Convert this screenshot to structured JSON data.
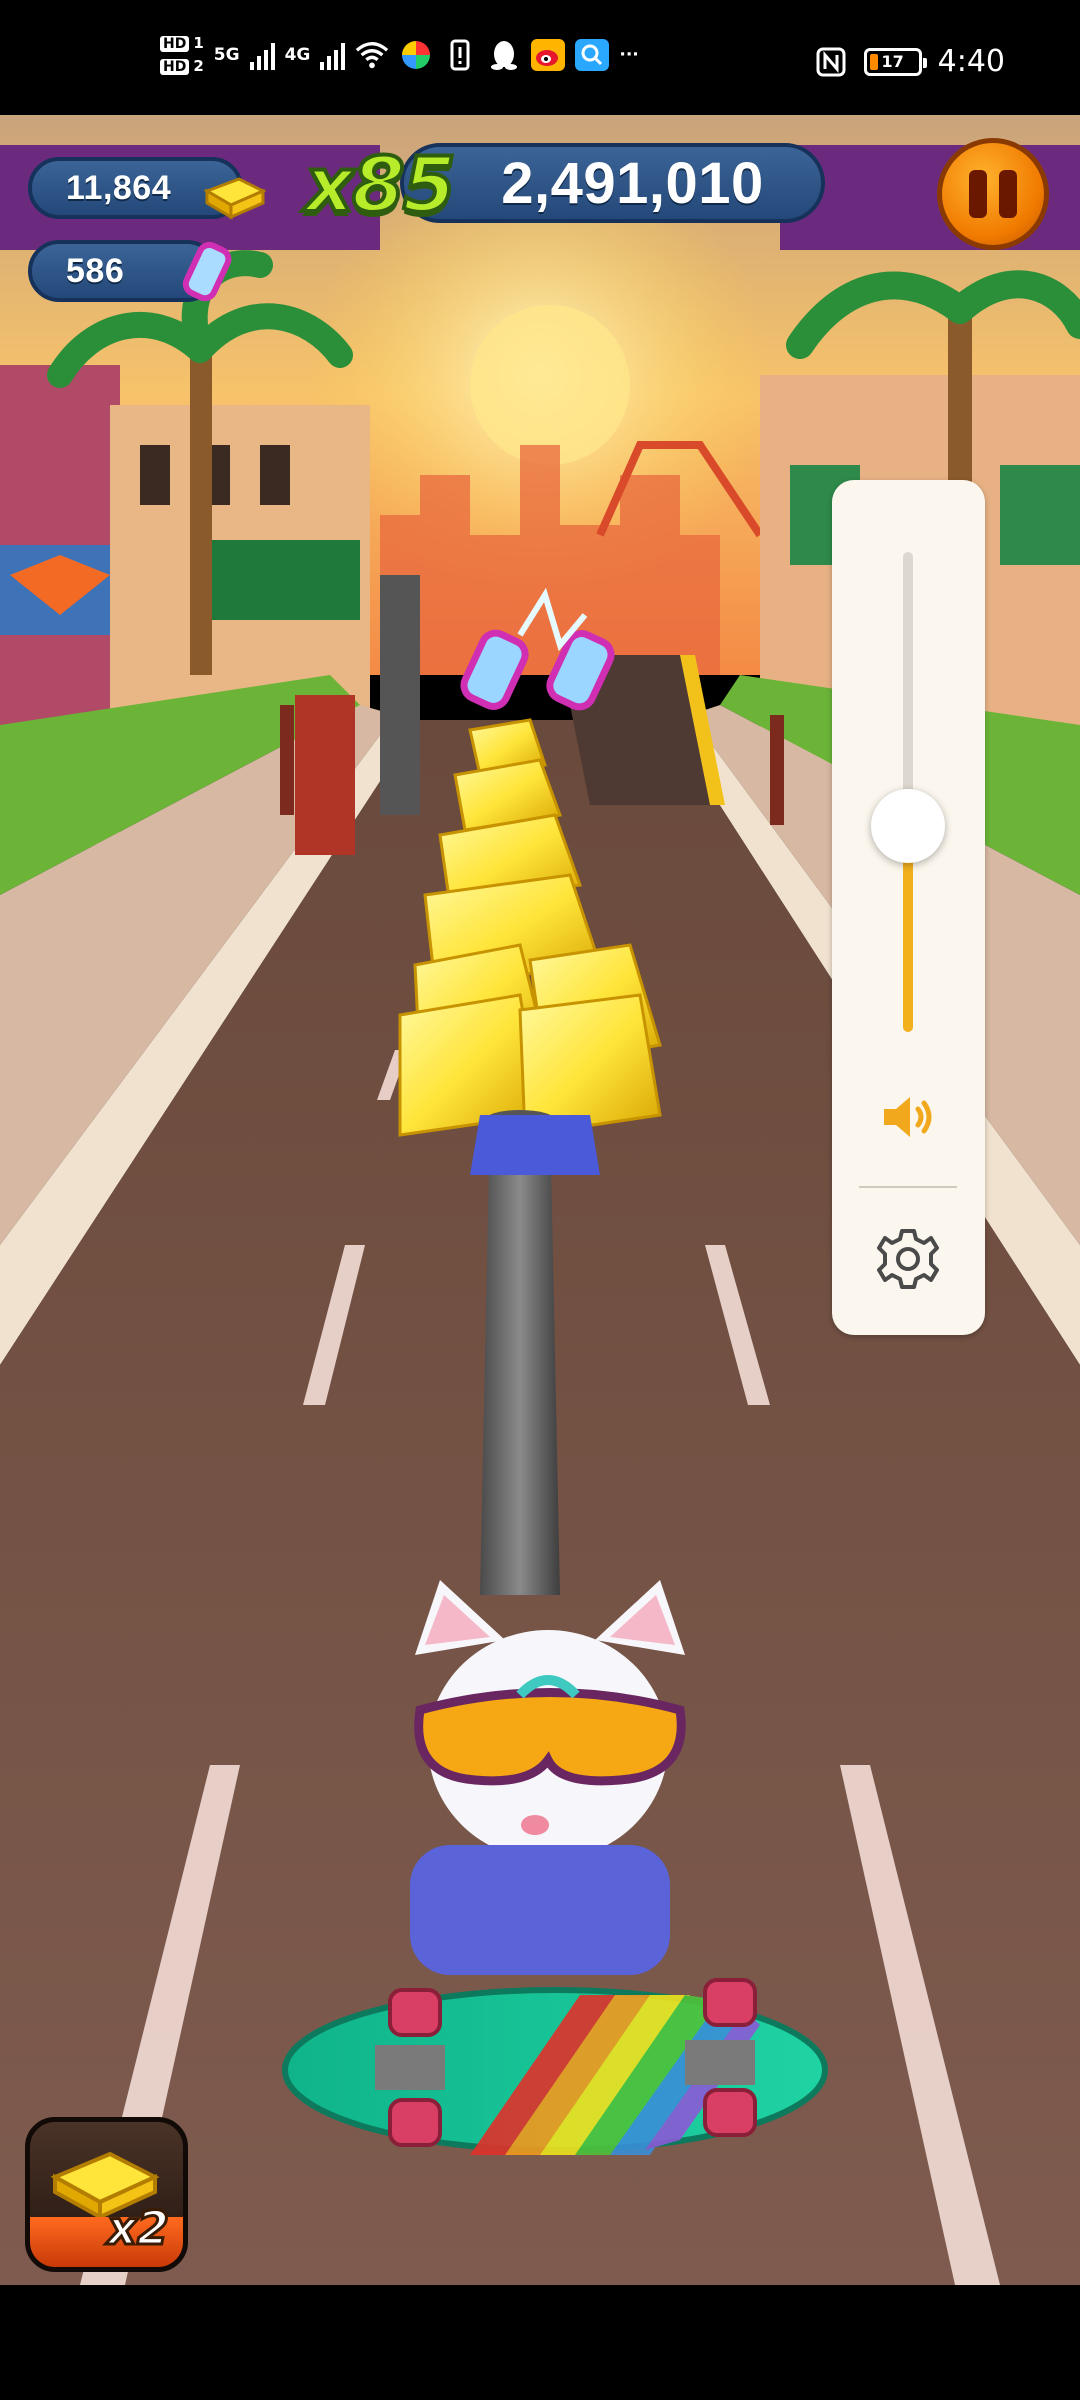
{
  "status_bar": {
    "time": "4:40",
    "battery": "17",
    "sim1": "HD",
    "sim1_index": "1",
    "sim2": "HD",
    "sim2_index": "2",
    "net1": "5G",
    "net2": "4G",
    "notification_icons": [
      "wifi-icon",
      "pinwheel-app-icon",
      "alert-icon",
      "qq-penguin-icon",
      "weibo-icon",
      "search-app-icon",
      "more-dots-icon"
    ],
    "right_icons": [
      "nfc-icon",
      "battery-icon"
    ],
    "more": "···"
  },
  "hud": {
    "gold_bars": "11,864",
    "gems": "586",
    "multiplier": "x85",
    "score": "2,491,010",
    "pause_icon": "pause-icon"
  },
  "volume_panel": {
    "level": 0.43,
    "speaker_icon": "speaker-icon",
    "settings_icon": "gear-icon"
  },
  "booster": {
    "label": "x2",
    "icon": "gold-bar-icon"
  },
  "colors": {
    "hud_pill": "#2b4f80",
    "multiplier": "#b6ec2a",
    "pause": "#f07a00",
    "volume_fill": "#f2b01d",
    "panel": "#fbf7ee"
  }
}
